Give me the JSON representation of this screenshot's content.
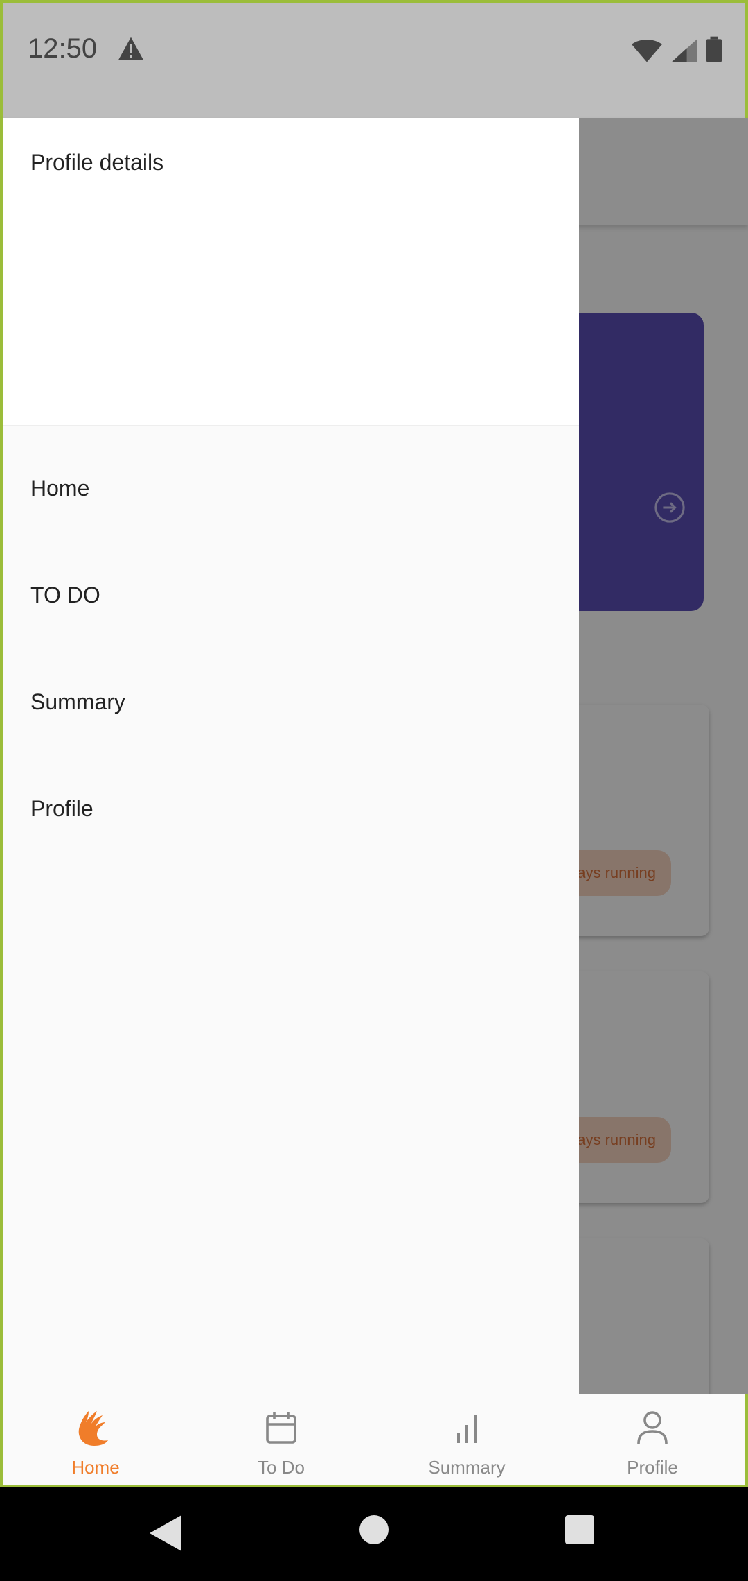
{
  "status_bar": {
    "time": "12:50"
  },
  "background": {
    "chip_1": "ays running",
    "chip_2": "ays running"
  },
  "drawer": {
    "header_title": "Profile details",
    "items": [
      {
        "label": "Home"
      },
      {
        "label": "TO DO"
      },
      {
        "label": "Summary"
      },
      {
        "label": "Profile"
      }
    ]
  },
  "bottom_nav": {
    "items": [
      {
        "label": "Home",
        "icon": "home-hand-icon",
        "active": true
      },
      {
        "label": "To Do",
        "icon": "calendar-icon",
        "active": false
      },
      {
        "label": "Summary",
        "icon": "bar-chart-icon",
        "active": false
      },
      {
        "label": "Profile",
        "icon": "person-icon",
        "active": false
      }
    ]
  },
  "colors": {
    "accent": "#f07d2a",
    "purple_card": "#5b4fb6",
    "frame": "#9bbd3a"
  }
}
